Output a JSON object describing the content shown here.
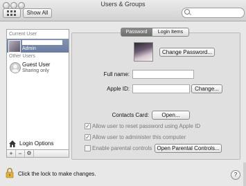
{
  "window": {
    "title": "Users & Groups"
  },
  "toolbar": {
    "show_all_label": "Show All",
    "search_placeholder": ""
  },
  "sidebar": {
    "current_user_header": "Current User",
    "current_user": {
      "name": "",
      "role": "Admin"
    },
    "other_users_header": "Other Users",
    "guest_user": {
      "name": "Guest User",
      "status": "Sharing only"
    },
    "login_options_label": "Login Options",
    "add_label": "+",
    "remove_label": "−",
    "action_label": "⚙"
  },
  "tabs": {
    "password": "Password",
    "login_items": "Login Items"
  },
  "password_pane": {
    "change_password_label": "Change Password...",
    "full_name_label": "Full name:",
    "full_name_value": "",
    "apple_id_label": "Apple ID:",
    "apple_id_value": "",
    "change_apple_id_label": "Change...",
    "contacts_card_label": "Contacts Card:",
    "open_contacts_label": "Open...",
    "allow_reset_label": "Allow user to reset password using Apple ID",
    "allow_reset_checked": true,
    "allow_admin_label": "Allow user to administer this computer",
    "allow_admin_checked": true,
    "parental_controls_label": "Enable parental controls",
    "parental_controls_checked": false,
    "open_parental_controls_label": "Open Parental Controls..."
  },
  "footer": {
    "lock_text": "Click the lock to make changes.",
    "help_label": "?"
  },
  "colors": {
    "selection": "#7385a6",
    "window_bg": "#e8e8e8",
    "selected_tab": "#7a7a7a"
  }
}
